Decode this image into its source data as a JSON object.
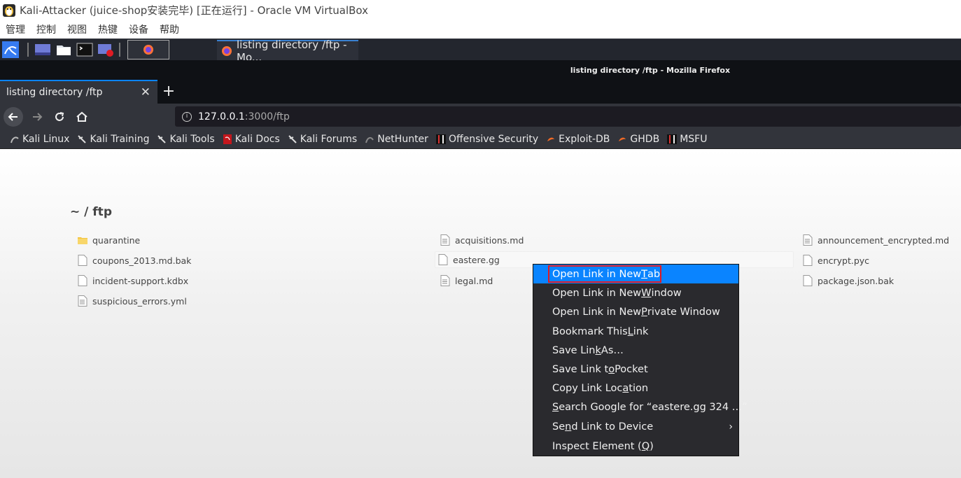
{
  "vbox": {
    "title": "Kali-Attacker (juice-shop安装完毕) [正在运行] - Oracle VM VirtualBox",
    "menu": [
      "管理",
      "控制",
      "视图",
      "热键",
      "设备",
      "帮助"
    ]
  },
  "taskbar": {
    "window_title": "listing directory /ftp - Mo..."
  },
  "firefox": {
    "window_title": "listing directory /ftp - Mozilla Firefox",
    "tab_title": "listing directory /ftp",
    "tab_close": "✕",
    "new_tab": "+",
    "url_host": "127.0.0.1",
    "url_rest": ":3000/ftp",
    "bookmarks": [
      "Kali Linux",
      "Kali Training",
      "Kali Tools",
      "Kali Docs",
      "Kali Forums",
      "NetHunter",
      "Offensive Security",
      "Exploit-DB",
      "GHDB",
      "MSFU"
    ]
  },
  "page": {
    "breadcrumb": "~ / ftp",
    "files": {
      "col1": [
        "quarantine",
        "coupons_2013.md.bak",
        "incident-support.kdbx",
        "suspicious_errors.yml"
      ],
      "col2": [
        "acquisitions.md",
        "eastere.gg",
        "legal.md"
      ],
      "col3": [
        "announcement_encrypted.md",
        "encrypt.pyc",
        "package.json.bak"
      ]
    }
  },
  "context_menu": {
    "items": [
      {
        "pre": "Open Link in New ",
        "u": "T",
        "post": "ab"
      },
      {
        "pre": "Open Link in New ",
        "u": "W",
        "post": "indow"
      },
      {
        "pre": "Open Link in New ",
        "u": "P",
        "post": "rivate Window"
      },
      {
        "pre": "Bookmark This ",
        "u": "L",
        "post": "ink"
      },
      {
        "pre": "Save Lin",
        "u": "k",
        "post": " As…"
      },
      {
        "pre": "Save Link t",
        "u": "o",
        "post": " Pocket"
      },
      {
        "pre": "Copy Link Loc",
        "u": "a",
        "post": "tion"
      },
      {
        "pre": "",
        "u": "S",
        "post": "earch Google for “eastere.gg 324 …”"
      },
      {
        "pre": "Se",
        "u": "n",
        "post": "d Link to Device"
      },
      {
        "pre": "Inspect Element (",
        "u": "Q",
        "post": ")"
      }
    ],
    "submenu_arrow": "›"
  }
}
